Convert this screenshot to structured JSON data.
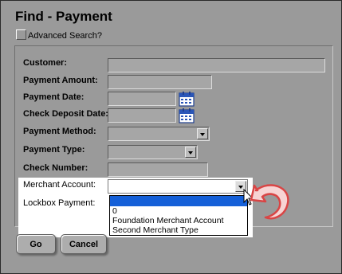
{
  "window": {
    "title": "Find - Payment"
  },
  "advanced_search": {
    "label": "Advanced Search?",
    "checked": false
  },
  "form": {
    "customer": {
      "label": "Customer:",
      "value": ""
    },
    "payment_amount": {
      "label": "Payment Amount:",
      "value": ""
    },
    "payment_date": {
      "label": "Payment Date:",
      "value": "",
      "icon": "calendar-icon"
    },
    "check_deposit_date": {
      "label": "Check Deposit Date:",
      "value": "",
      "icon": "calendar-icon"
    },
    "payment_method": {
      "label": "Payment Method:",
      "value": ""
    },
    "payment_type": {
      "label": "Payment Type:",
      "value": ""
    },
    "check_number": {
      "label": "Check Number:",
      "value": ""
    },
    "merchant_account": {
      "label": "Merchant Account:",
      "value": "",
      "options": [
        "",
        "0",
        "Foundation Merchant Account",
        "Second Merchant Type"
      ],
      "highlighted_option": ""
    },
    "lockbox_payment": {
      "label": "Lockbox Payment:"
    }
  },
  "buttons": {
    "go": "Go",
    "cancel": "Cancel"
  },
  "colors": {
    "background": "#9a9a9a",
    "highlight": "#1560d8",
    "annotation_arrow": "#e06060"
  }
}
